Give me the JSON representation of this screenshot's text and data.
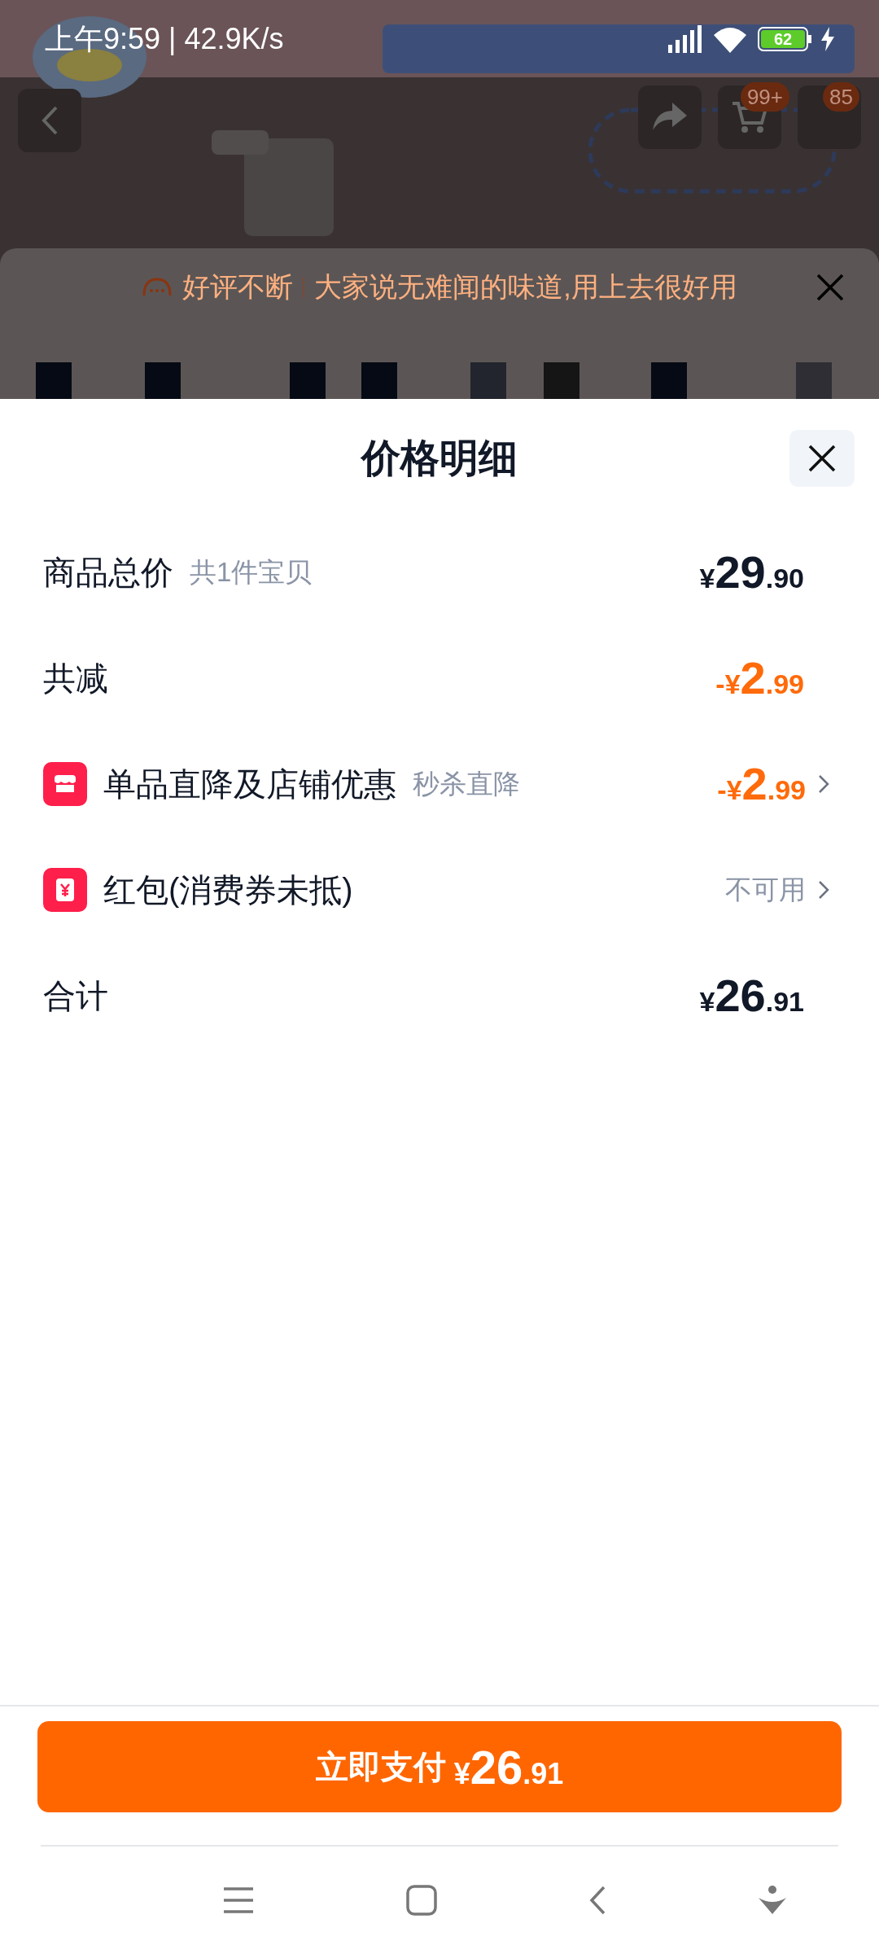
{
  "status_bar": {
    "time": "上午9:59 | 42.9K/s",
    "battery": "62"
  },
  "header": {
    "cart_badge": "99+",
    "more_badge": "85"
  },
  "banner": {
    "tag": "好评不断",
    "text": "大家说无难闻的味道,用上去很好用"
  },
  "sheet": {
    "title": "价格明细",
    "rows": [
      {
        "kind": "plain",
        "label": "商品总价",
        "note": "共1件宝贝",
        "highlight": false,
        "price": {
          "prefix": "¥",
          "main": "29",
          "fraction": ".90"
        }
      },
      {
        "kind": "plain",
        "label": "共减",
        "highlight": true,
        "price": {
          "prefix": "-¥",
          "main": "2",
          "fraction": ".99"
        }
      },
      {
        "kind": "store",
        "label": "单品直降及店铺优惠",
        "note": "秒杀直降",
        "highlight": true,
        "price": {
          "prefix": "-¥",
          "main": "2",
          "fraction": ".99"
        }
      },
      {
        "kind": "coupon",
        "label": "红包(消费券未抵)",
        "status": "不可用"
      },
      {
        "kind": "plain",
        "label": "合计",
        "highlight": false,
        "price": {
          "prefix": "¥",
          "main": "26",
          "fraction": ".91"
        }
      }
    ]
  },
  "pay_button": {
    "label": "立即支付",
    "price": {
      "prefix": "¥",
      "main": "26",
      "fraction": ".91"
    }
  }
}
